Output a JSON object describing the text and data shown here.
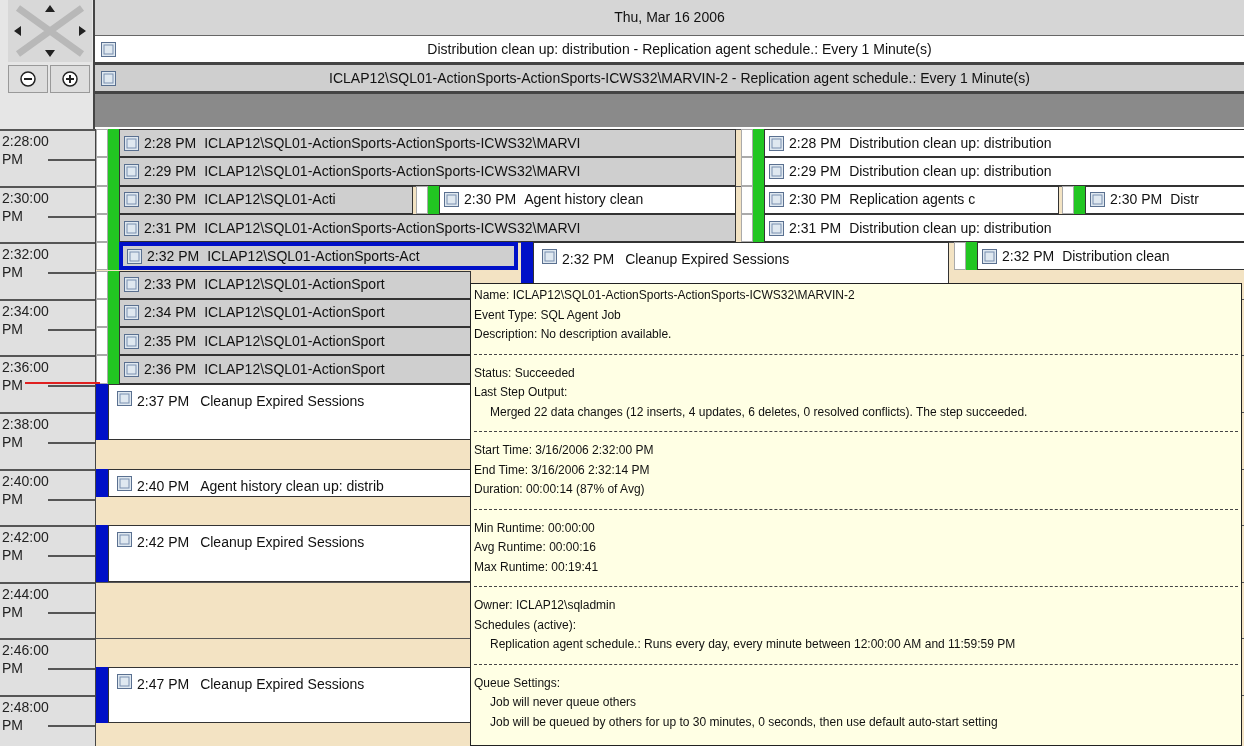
{
  "calendar": {
    "date_header": "Thu, Mar 16 2006",
    "all_day_events": [
      {
        "text": "Distribution clean up: distribution  -  Replication agent schedule.:  Every 1 Minute(s)",
        "highlighted": false
      },
      {
        "text": "ICLAP12\\SQL01-ActionSports-ActionSports-ICWS32\\MARVIN-2  -  Replication agent schedule.: Every 1 Minute(s)",
        "highlighted": true
      }
    ],
    "time_slots": [
      {
        "time": "2:28:00",
        "period": "PM"
      },
      {
        "time": "2:30:00",
        "period": "PM"
      },
      {
        "time": "2:32:00",
        "period": "PM"
      },
      {
        "time": "2:34:00",
        "period": "PM"
      },
      {
        "time": "2:36:00",
        "period": "PM"
      },
      {
        "time": "2:38:00",
        "period": "PM"
      },
      {
        "time": "2:40:00",
        "period": "PM"
      },
      {
        "time": "2:42:00",
        "period": "PM"
      },
      {
        "time": "2:44:00",
        "period": "PM"
      },
      {
        "time": "2:46:00",
        "period": "PM"
      },
      {
        "time": "2:48:00",
        "period": "PM"
      }
    ],
    "events": [
      {
        "kind": "job",
        "time": "2:28 PM",
        "title": "ICLAP12\\SQL01-ActionSports-ActionSports-ICWS32\\MARVI",
        "selected": false
      },
      {
        "kind": "job",
        "time": "2:29 PM",
        "title": "ICLAP12\\SQL01-ActionSports-ActionSports-ICWS32\\MARVI",
        "selected": false
      },
      {
        "kind": "job",
        "time": "2:30 PM",
        "title": "ICLAP12\\SQL01-Acti",
        "selected": false
      },
      {
        "kind": "job",
        "time": "2:30 PM",
        "title": "Agent history clean",
        "selected": false
      },
      {
        "kind": "job",
        "time": "2:31 PM",
        "title": "ICLAP12\\SQL01-ActionSports-ActionSports-ICWS32\\MARVI",
        "selected": false
      },
      {
        "kind": "job",
        "time": "2:28 PM",
        "title": "Distribution clean up: distribution",
        "selected": false
      },
      {
        "kind": "job",
        "time": "2:29 PM",
        "title": "Distribution clean up: distribution",
        "selected": false
      },
      {
        "kind": "job",
        "time": "2:30 PM",
        "title": "Replication agents c",
        "selected": false
      },
      {
        "kind": "job",
        "time": "2:30 PM",
        "title": "Distr",
        "selected": false
      },
      {
        "kind": "job",
        "time": "2:31 PM",
        "title": "Distribution clean up: distribution",
        "selected": false
      },
      {
        "kind": "job",
        "time": "2:32 PM",
        "title": "ICLAP12\\SQL01-ActionSports-Act",
        "selected": true
      },
      {
        "kind": "job",
        "time": "2:33 PM",
        "title": "ICLAP12\\SQL01-ActionSport",
        "selected": false
      },
      {
        "kind": "job",
        "time": "2:34 PM",
        "title": "ICLAP12\\SQL01-ActionSport",
        "selected": false
      },
      {
        "kind": "job",
        "time": "2:35 PM",
        "title": "ICLAP12\\SQL01-ActionSport",
        "selected": false
      },
      {
        "kind": "job",
        "time": "2:36 PM",
        "title": "ICLAP12\\SQL01-ActionSport",
        "selected": false
      },
      {
        "kind": "task",
        "time": "2:32 PM",
        "title": "Cleanup Expired Sessions",
        "selected": false
      },
      {
        "kind": "job",
        "time": "2:32 PM",
        "title": "Distribution clean",
        "selected": false
      },
      {
        "kind": "task",
        "time": "2:37 PM",
        "title": "Cleanup Expired Sessions",
        "selected": false
      },
      {
        "kind": "task",
        "time": "2:40 PM",
        "title": "Agent history clean up: distrib",
        "selected": false
      },
      {
        "kind": "task",
        "time": "2:42 PM",
        "title": "Cleanup Expired Sessions",
        "selected": false
      },
      {
        "kind": "task",
        "time": "2:47 PM",
        "title": "Cleanup Expired Sessions",
        "selected": false
      }
    ],
    "tooltip": {
      "sections": [
        [
          {
            "text": "Name: ICLAP12\\SQL01-ActionSports-ActionSports-ICWS32\\MARVIN-2",
            "indented": false
          },
          {
            "text": "Event Type: SQL Agent Job",
            "indented": false
          },
          {
            "text": "Description: No description available.",
            "indented": false
          }
        ],
        [
          {
            "text": "Status: Succeeded",
            "indented": false
          },
          {
            "text": "Last Step Output:",
            "indented": false
          },
          {
            "text": "Merged 22 data changes (12 inserts, 4 updates, 6 deletes, 0 resolved conflicts).  The step succeeded.",
            "indented": true
          }
        ],
        [
          {
            "text": "Start Time: 3/16/2006 2:32:00 PM",
            "indented": false
          },
          {
            "text": "End Time: 3/16/2006 2:32:14 PM",
            "indented": false
          },
          {
            "text": "Duration: 00:00:14 (87% of Avg)",
            "indented": false
          }
        ],
        [
          {
            "text": "Min Runtime: 00:00:00",
            "indented": false
          },
          {
            "text": "Avg Runtime: 00:00:16",
            "indented": false
          },
          {
            "text": "Max Runtime: 00:19:41",
            "indented": false
          }
        ],
        [
          {
            "text": "Owner: ICLAP12\\sqladmin",
            "indented": false
          },
          {
            "text": "Schedules (active):",
            "indented": false
          },
          {
            "text": "Replication agent schedule.:  Runs every day, every minute between 12:00:00 AM and 11:59:59 PM",
            "indented": true
          }
        ],
        [
          {
            "text": "Queue Settings:",
            "indented": false
          },
          {
            "text": "Job will never queue others",
            "indented": true
          },
          {
            "text": "Job will be queued by others for up to 30 minutes, 0 seconds, then use default auto-start setting",
            "indented": true
          }
        ]
      ]
    }
  }
}
